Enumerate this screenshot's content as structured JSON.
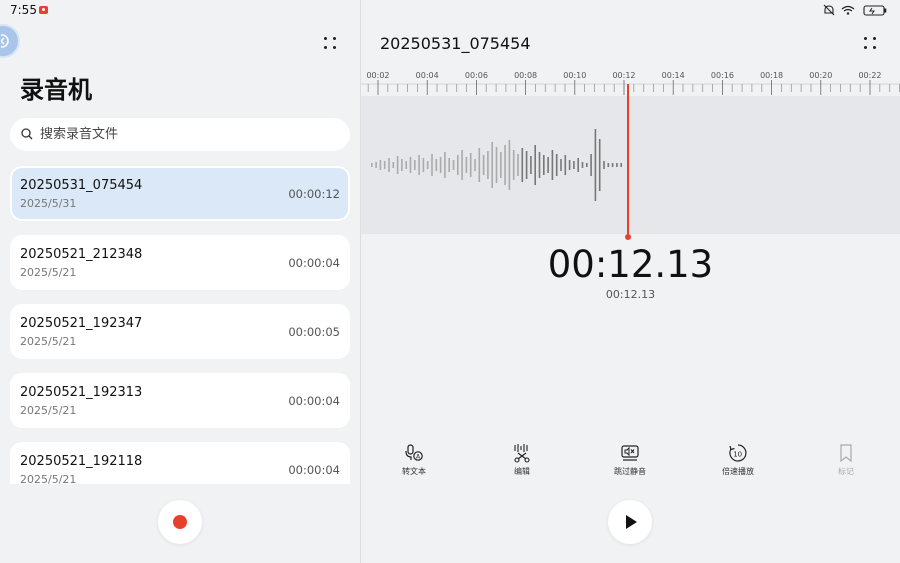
{
  "status_bar": {
    "time": "7:55"
  },
  "left": {
    "app_title": "录音机",
    "search_placeholder": "搜索录音文件",
    "recordings": [
      {
        "name": "20250531_075454",
        "date": "2025/5/31",
        "duration": "00:00:12",
        "selected": true
      },
      {
        "name": "20250521_212348",
        "date": "2025/5/21",
        "duration": "00:00:04",
        "selected": false
      },
      {
        "name": "20250521_192347",
        "date": "2025/5/21",
        "duration": "00:00:05",
        "selected": false
      },
      {
        "name": "20250521_192313",
        "date": "2025/5/21",
        "duration": "00:00:04",
        "selected": false
      },
      {
        "name": "20250521_192118",
        "date": "2025/5/21",
        "duration": "00:00:04",
        "selected": false
      }
    ]
  },
  "right": {
    "file_title": "20250531_075454",
    "ruler_labels": [
      "00:02",
      "00:04",
      "00:06",
      "00:08",
      "00:10",
      "00:12",
      "00:14",
      "00:16",
      "00:18",
      "00:20",
      "00:22"
    ],
    "current_time": "00:12.13",
    "sub_time": "00:12.13",
    "tools": [
      {
        "label": "转文本",
        "icon": "speech-to-text-icon",
        "enabled": true
      },
      {
        "label": "编辑",
        "icon": "scissors-edit-icon",
        "enabled": true
      },
      {
        "label": "跳过静音",
        "icon": "skip-silence-icon",
        "enabled": true
      },
      {
        "label": "倍速播放",
        "icon": "playback-speed-icon",
        "enabled": true
      },
      {
        "label": "标记",
        "icon": "bookmark-icon",
        "enabled": false
      }
    ]
  },
  "colors": {
    "accent_red": "#e8402f",
    "selected_bg": "#dbe8f7"
  }
}
